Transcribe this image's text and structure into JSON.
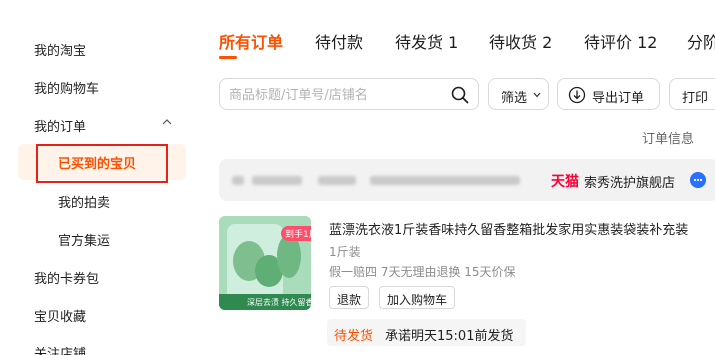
{
  "sidebar": {
    "items": [
      {
        "label": "我的淘宝"
      },
      {
        "label": "我的购物车"
      },
      {
        "label": "我的订单"
      },
      {
        "label": "我的卡券包"
      },
      {
        "label": "宝贝收藏"
      },
      {
        "label": "关注店铺"
      }
    ],
    "order_subitems": [
      {
        "label": "已买到的宝贝",
        "active": true
      },
      {
        "label": "我的拍卖"
      },
      {
        "label": "官方集运"
      }
    ]
  },
  "tabs": [
    {
      "label": "所有订单",
      "active": true
    },
    {
      "label": "待付款"
    },
    {
      "label": "待发货 1"
    },
    {
      "label": "待收货 2"
    },
    {
      "label": "待评价 12"
    },
    {
      "label": "分阶"
    }
  ],
  "toolbar": {
    "search_placeholder": "商品标题/订单号/店铺名",
    "filter_label": "筛选",
    "export_label": "导出订单",
    "print_label": "打印"
  },
  "column_header": "订单信息",
  "order": {
    "platform_logo": "天猫",
    "shop_name": "索秀洗护旗舰店",
    "product": {
      "title": "蓝漂洗衣液1斤装香味持久留香整箱批发家用实惠装袋装补充装",
      "spec": "1斤装",
      "guarantee": "假一赔四 7天无理由退换 15天价保",
      "image_badge": "到手1斤",
      "image_caption": "深层去渍 持久留香"
    },
    "actions": {
      "refund_label": "退款",
      "cart_label": "加入购物车"
    },
    "status": "待发货",
    "ship_promise": "承诺明天15:01前发货"
  },
  "colors": {
    "accent": "#ff5000",
    "highlight_box": "#e2231a",
    "tmall": "#ff0036"
  }
}
